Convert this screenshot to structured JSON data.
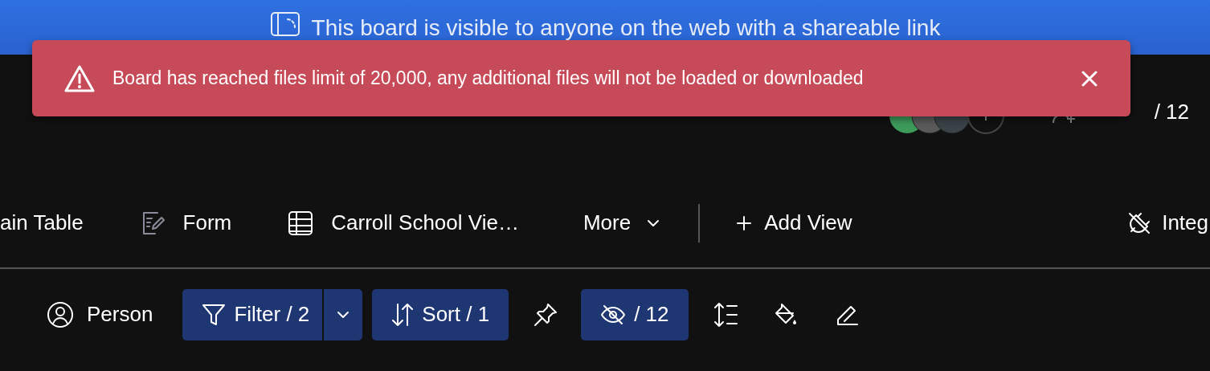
{
  "banner": {
    "text": "This board is visible to anyone on the web with a shareable link"
  },
  "toast": {
    "text": "Board has reached files limit of 20,000, any additional files will not be loaded or downloaded"
  },
  "header": {
    "invite": "/ 12"
  },
  "views": [
    {
      "label": "ain Table"
    },
    {
      "label": "Form"
    },
    {
      "label": "Carroll School Vie…"
    }
  ],
  "more": {
    "label": "More"
  },
  "add_view": {
    "label": "Add View"
  },
  "integrate": {
    "label": "Integ"
  },
  "toolbar": {
    "person": "Person",
    "filter": "Filter / 2",
    "sort": "Sort / 1",
    "hidden": "/ 12"
  }
}
